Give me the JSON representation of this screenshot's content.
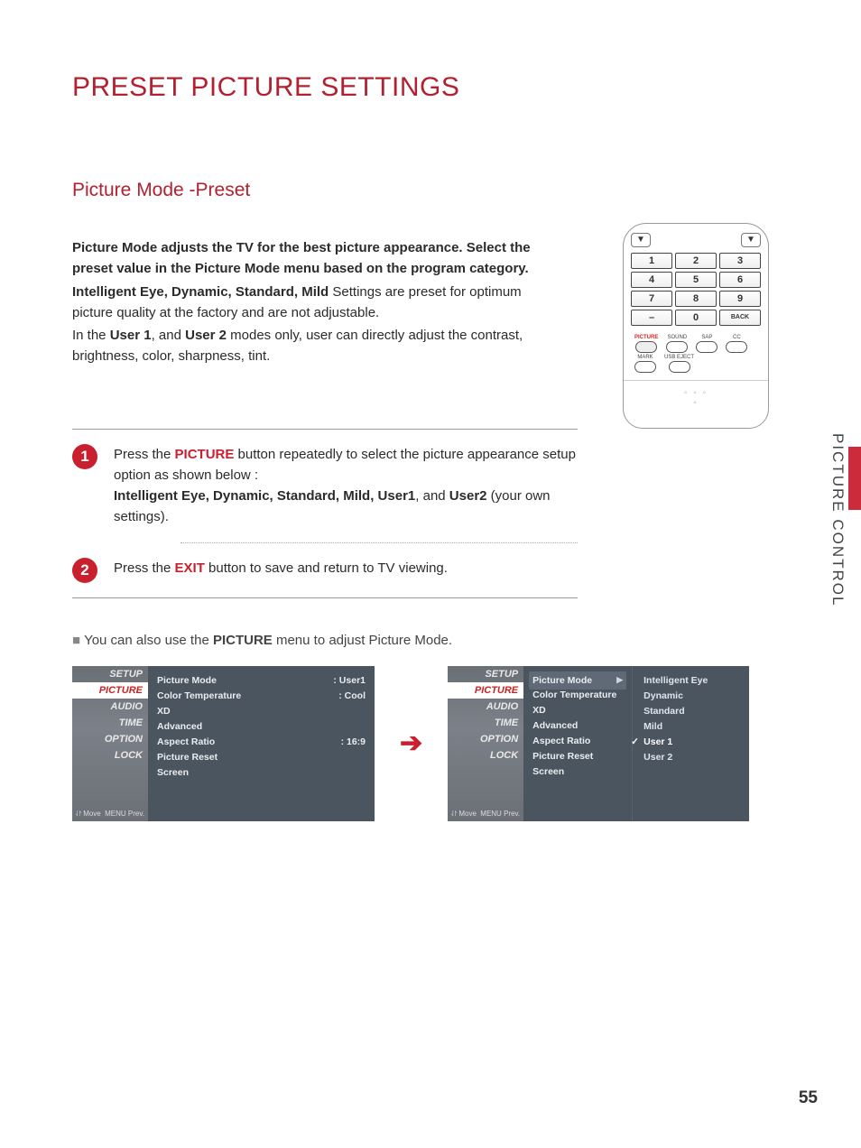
{
  "title": "PRESET PICTURE SETTINGS",
  "subtitle": "Picture Mode -Preset",
  "intro": {
    "p1": "Picture Mode adjusts the TV for the best picture appearance. Select the preset value in the Picture Mode menu based on the program category.",
    "p2a": "Intelligent Eye, Dynamic, Standard, Mild",
    "p2b": " Settings are preset for optimum picture quality at the factory and are not adjustable.",
    "p3a": "In the ",
    "p3b": "User 1",
    "p3c": ", and ",
    "p3d": "User 2",
    "p3e": " modes only, user can directly adjust the contrast, brightness, color, sharpness, tint."
  },
  "side_label": "PICTURE CONTROL",
  "remote": {
    "numpad": [
      "1",
      "2",
      "3",
      "4",
      "5",
      "6",
      "7",
      "8",
      "9",
      "–",
      "0",
      "BACK"
    ],
    "row1": [
      {
        "label": "PICTURE",
        "cls": "picture"
      },
      {
        "label": "SOUND",
        "cls": ""
      },
      {
        "label": "SAP",
        "cls": ""
      },
      {
        "label": "CC",
        "cls": ""
      }
    ],
    "row2": [
      {
        "label": "MARK",
        "cls": ""
      },
      {
        "label": "USB EJECT",
        "cls": ""
      }
    ]
  },
  "steps": {
    "s1": {
      "num": "1",
      "a": "Press the ",
      "kw": "PICTURE",
      "b": " button repeatedly to select the picture appearance setup option as shown below :",
      "c": "Intelligent Eye, Dynamic, Standard, Mild, User1",
      "d": ", and ",
      "e": "User2",
      "f": " (your own settings)."
    },
    "s2": {
      "num": "2",
      "a": "Press the ",
      "kw": "EXIT",
      "b": " button to save and return to TV viewing."
    }
  },
  "note": {
    "a": "You can also use the ",
    "b": "PICTURE",
    "c": " menu to adjust Picture Mode."
  },
  "osd": {
    "menu": [
      "SETUP",
      "PICTURE",
      "AUDIO",
      "TIME",
      "OPTION",
      "LOCK"
    ],
    "bottom_move": "Move",
    "bottom_prev": "Prev.",
    "left": {
      "rows": [
        {
          "label": "Picture Mode",
          "value": ": User1"
        },
        {
          "label": "Color Temperature",
          "value": ": Cool"
        },
        {
          "label": "XD",
          "value": ""
        },
        {
          "label": "Advanced",
          "value": ""
        },
        {
          "label": "Aspect Ratio",
          "value": ": 16:9"
        },
        {
          "label": "Picture Reset",
          "value": ""
        },
        {
          "label": "Screen",
          "value": ""
        }
      ]
    },
    "right": {
      "rows": [
        {
          "label": "Picture Mode",
          "value": "▶",
          "sel": true
        },
        {
          "label": "Color Temperature",
          "value": ""
        },
        {
          "label": "XD",
          "value": ""
        },
        {
          "label": "Advanced",
          "value": ""
        },
        {
          "label": "Aspect Ratio",
          "value": ""
        },
        {
          "label": "Picture Reset",
          "value": ""
        },
        {
          "label": "Screen",
          "value": ""
        }
      ],
      "options": [
        {
          "label": "Intelligent Eye",
          "sel": false,
          "check": false
        },
        {
          "label": "Dynamic",
          "sel": false,
          "check": false
        },
        {
          "label": "Standard",
          "sel": false,
          "check": false
        },
        {
          "label": "Mild",
          "sel": false,
          "check": false
        },
        {
          "label": "User 1",
          "sel": true,
          "check": true
        },
        {
          "label": "User 2",
          "sel": false,
          "check": false
        }
      ]
    }
  },
  "page_number": "55"
}
